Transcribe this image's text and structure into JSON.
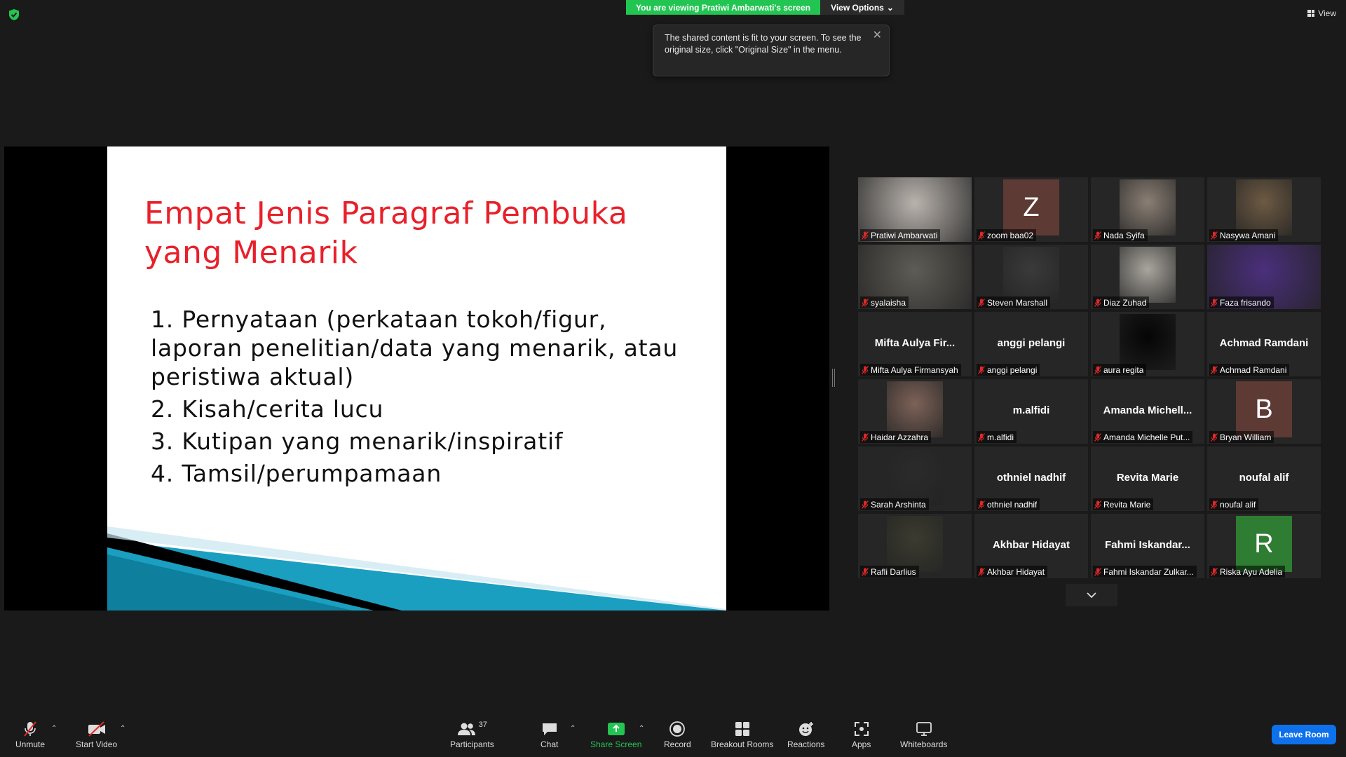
{
  "banner": {
    "viewing_text": "You are viewing Pratiwi Ambarwati's screen",
    "view_options_label": "View Options"
  },
  "top_right": {
    "view_label": "View"
  },
  "tooltip": {
    "text": "The shared content is fit to your screen. To see the original size, click \"Original Size\" in the menu."
  },
  "slide": {
    "title_line1": "Empat Jenis Paragraf Pembuka",
    "title_line2": "yang Menarik",
    "items": [
      "1. Pernyataan (perkataan tokoh/figur, laporan penelitian/data yang menarik, atau peristiwa aktual)",
      "2. Kisah/cerita lucu",
      "3. Kutipan yang menarik/inspiratif",
      "4. Tamsil/perumpamaan"
    ]
  },
  "participants": [
    {
      "name": "Pratiwi Ambarwati",
      "kind": "video",
      "active": true,
      "tone": "#b9b3ad"
    },
    {
      "name": "zoom baa02",
      "kind": "letter",
      "letter": "Z",
      "color": "#5e3a35"
    },
    {
      "name": "Nada Syifa",
      "kind": "video",
      "tone": "#8a7f74"
    },
    {
      "name": "Nasywa Amani",
      "kind": "video",
      "tone": "#6d5a43"
    },
    {
      "name": "syalaisha",
      "kind": "video",
      "tone": "#5e5c55"
    },
    {
      "name": "Steven Marshall",
      "kind": "video",
      "tone": "#3a3a3a"
    },
    {
      "name": "Diaz Zuhad",
      "kind": "video",
      "tone": "#a9a59e"
    },
    {
      "name": "Faza frisando",
      "kind": "video",
      "tone": "#4b2f7c"
    },
    {
      "name": "Mifta Aulya Firmansyah",
      "kind": "name",
      "display": "Mifta Aulya Fir..."
    },
    {
      "name": "anggi pelangi",
      "kind": "name",
      "display": "anggi pelangi"
    },
    {
      "name": "aura regita",
      "kind": "video",
      "tone": "#050505"
    },
    {
      "name": "Achmad Ramdani",
      "kind": "name",
      "display": "Achmad Ramdani"
    },
    {
      "name": "Haidar Azzahra",
      "kind": "video",
      "tone": "#7d6258"
    },
    {
      "name": "m.alfidi",
      "kind": "name",
      "display": "m.alfidi"
    },
    {
      "name": "Amanda Michelle Put...",
      "kind": "name",
      "display": "Amanda  Michell..."
    },
    {
      "name": "Bryan William",
      "kind": "letter",
      "letter": "B",
      "color": "#5e3a35"
    },
    {
      "name": "Sarah Arshinta",
      "kind": "video",
      "tone": "#2b2b2b"
    },
    {
      "name": "othniel nadhif",
      "kind": "name",
      "display": "othniel nadhif"
    },
    {
      "name": "Revita Marie",
      "kind": "name",
      "display": "Revita Marie"
    },
    {
      "name": "noufal alif",
      "kind": "name",
      "display": "noufal alif"
    },
    {
      "name": "Rafli Darlius",
      "kind": "video",
      "tone": "#3b3b30"
    },
    {
      "name": "Akhbar Hidayat",
      "kind": "name",
      "display": "Akhbar Hidayat"
    },
    {
      "name": "Fahmi Iskandar Zulkar...",
      "kind": "name",
      "display": "Fahmi  Iskandar..."
    },
    {
      "name": "Riska Ayu Adelia",
      "kind": "letter",
      "letter": "R",
      "color": "#2e7d32"
    }
  ],
  "toolbar": {
    "unmute": "Unmute",
    "start_video": "Start Video",
    "participants": "Participants",
    "participants_count": "37",
    "chat": "Chat",
    "share_screen": "Share Screen",
    "record": "Record",
    "breakout_rooms": "Breakout Rooms",
    "reactions": "Reactions",
    "apps": "Apps",
    "whiteboards": "Whiteboards",
    "leave_room": "Leave Room"
  },
  "colors": {
    "share_green": "#23c552",
    "leave_blue": "#0e71eb",
    "slide_title_red": "#e8202a",
    "active_speaker": "#e6e67a"
  }
}
